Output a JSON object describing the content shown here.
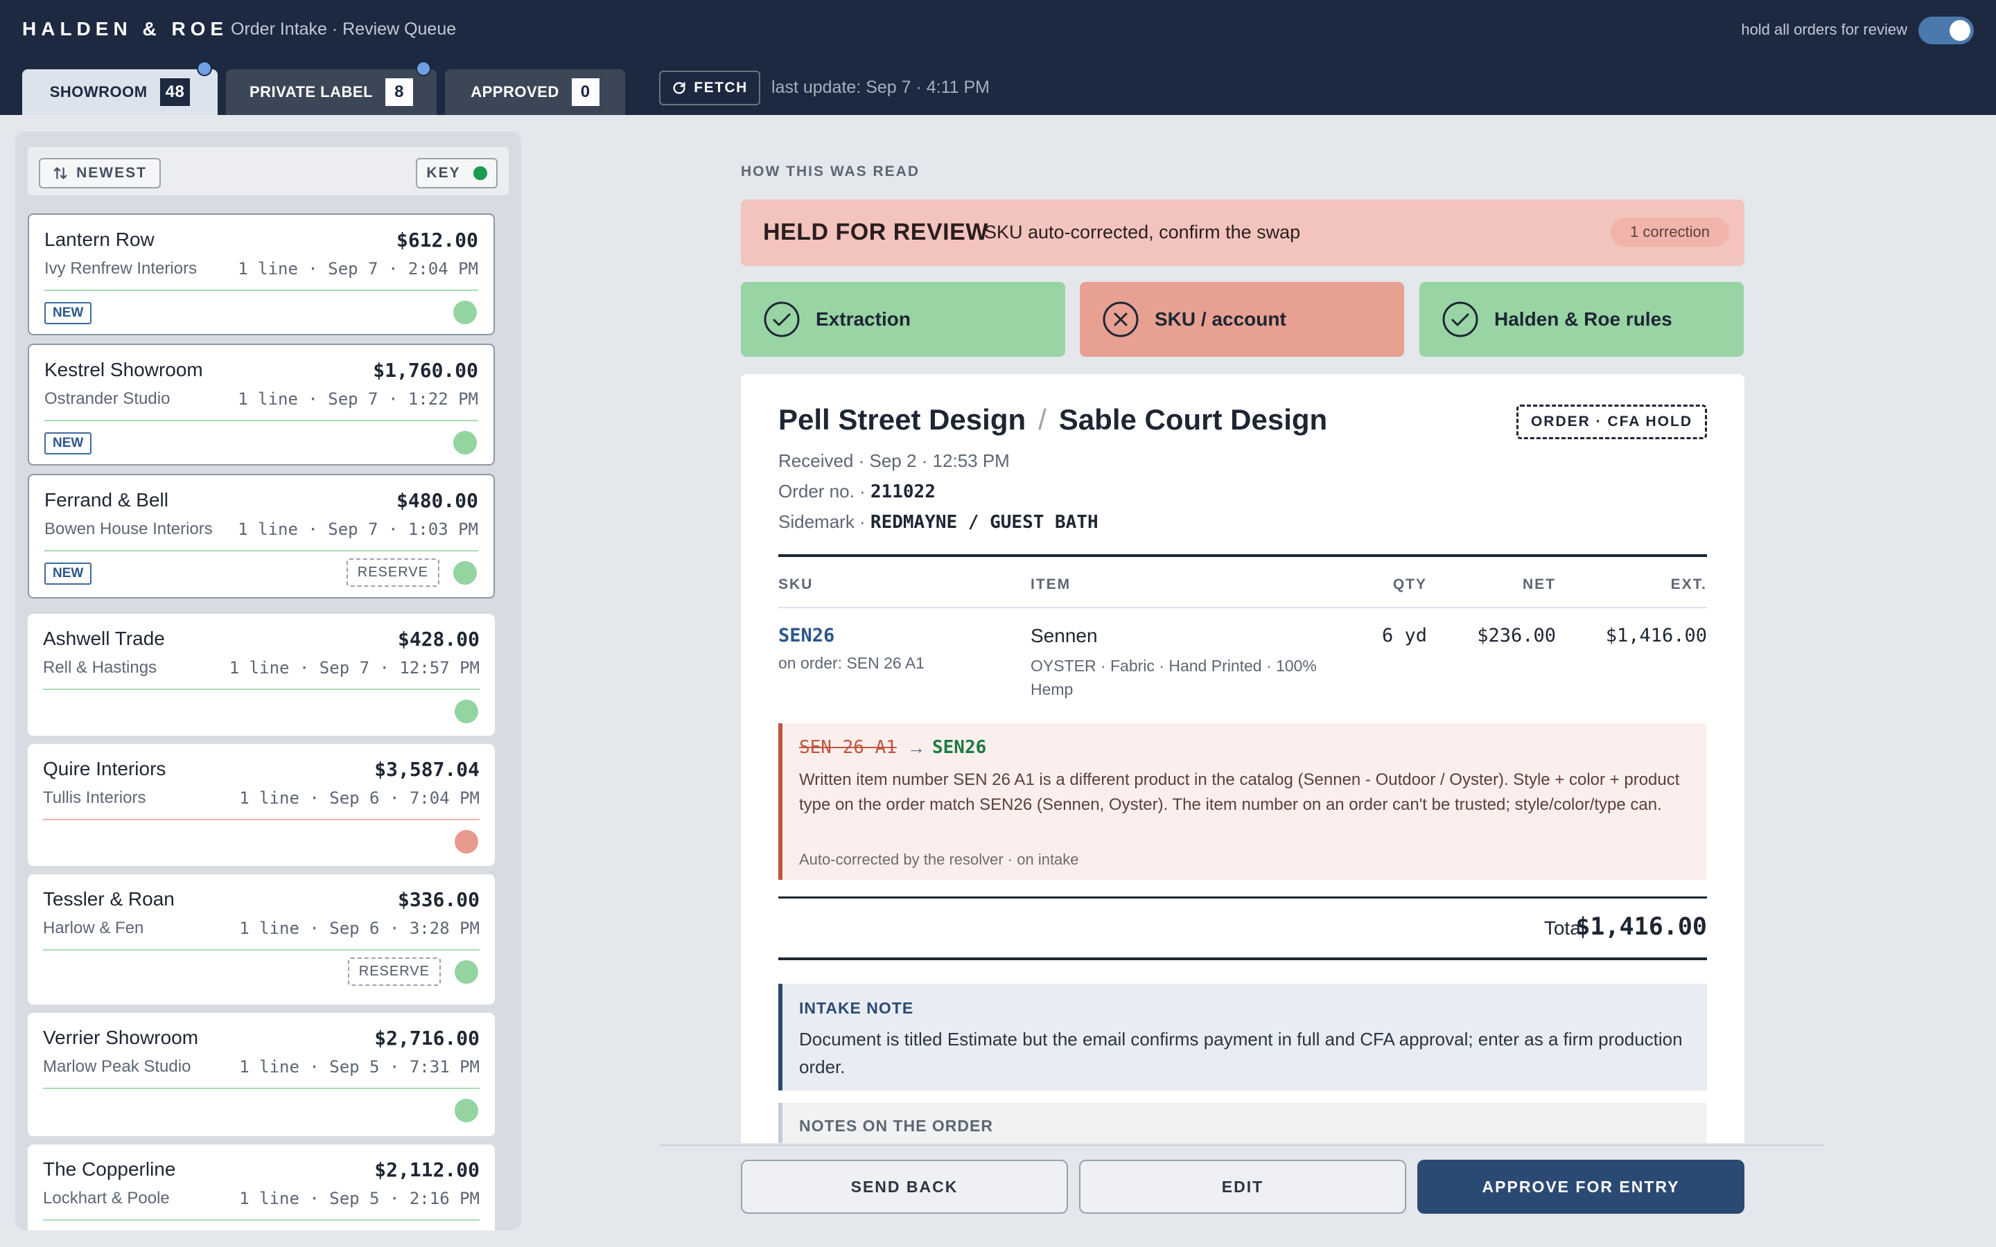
{
  "header": {
    "brand": "HALDEN & ROE",
    "subtitle": "Order Intake · Review Queue",
    "hold_label": "hold all orders for review",
    "tabs": [
      {
        "label": "SHOWROOM",
        "count": "48"
      },
      {
        "label": "PRIVATE LABEL",
        "count": "8"
      },
      {
        "label": "APPROVED",
        "count": "0"
      }
    ],
    "fetch_label": "FETCH",
    "last_update": "last update: Sep 7 · 4:11 PM",
    "colors": {
      "bar": "#1c2940",
      "accent": "#4b78ad",
      "unread_dot": "#6fa0e4"
    }
  },
  "sidebar": {
    "sort_label": "NEWEST",
    "key_label": "KEY",
    "orders": [
      {
        "name": "Lantern Row",
        "amount": "$612.00",
        "client": "Ivy Renfrew Interiors",
        "meta": "1 line · Sep 7 · 2:04 PM",
        "badge": "NEW",
        "reserve": "",
        "status": "green"
      },
      {
        "name": "Kestrel Showroom",
        "amount": "$1,760.00",
        "client": "Ostrander Studio",
        "meta": "1 line · Sep 7 · 1:22 PM",
        "badge": "NEW",
        "reserve": "",
        "status": "green"
      },
      {
        "name": "Ferrand & Bell",
        "amount": "$480.00",
        "client": "Bowen House Interiors",
        "meta": "1 line · Sep 7 · 1:03 PM",
        "badge": "NEW",
        "reserve": "RESERVE",
        "status": "green"
      },
      {
        "name": "Ashwell Trade",
        "amount": "$428.00",
        "client": "Rell & Hastings",
        "meta": "1 line · Sep 7 · 12:57 PM",
        "badge": "",
        "reserve": "",
        "status": "green"
      },
      {
        "name": "Quire Interiors",
        "amount": "$3,587.04",
        "client": "Tullis Interiors",
        "meta": "1 line · Sep 6 · 7:04 PM",
        "badge": "",
        "reserve": "",
        "status": "red"
      },
      {
        "name": "Tessler & Roan",
        "amount": "$336.00",
        "client": "Harlow & Fen",
        "meta": "1 line · Sep 6 · 3:28 PM",
        "badge": "",
        "reserve": "RESERVE",
        "status": "green"
      },
      {
        "name": "Verrier Showroom",
        "amount": "$2,716.00",
        "client": "Marlow Peak Studio",
        "meta": "1 line · Sep 5 · 7:31 PM",
        "badge": "",
        "reserve": "",
        "status": "green"
      },
      {
        "name": "The Copperline",
        "amount": "$2,112.00",
        "client": "Lockhart & Poole",
        "meta": "1 line · Sep 5 · 2:16 PM",
        "badge": "",
        "reserve": "",
        "status": "green"
      }
    ]
  },
  "review": {
    "section_label": "HOW THIS WAS READ",
    "held_title": "HELD FOR REVIEW",
    "held_sub": "SKU auto-corrected, confirm the swap",
    "held_count": "1 correction",
    "checks": [
      {
        "label": "Extraction",
        "state": "ok"
      },
      {
        "label": "SKU / account",
        "state": "bad"
      },
      {
        "label": "Halden & Roe rules",
        "state": "ok"
      }
    ]
  },
  "order": {
    "account": "Pell Street Design",
    "ship_to": "Sable Court Design",
    "stamp": "ORDER · CFA HOLD",
    "received": "Received · Sep 2 · 12:53 PM",
    "order_no_label": "Order no. · ",
    "order_no": "211022",
    "sidemark_label": "Sidemark · ",
    "sidemark": "REDMAYNE / GUEST BATH",
    "columns": {
      "sku": "SKU",
      "item": "ITEM",
      "qty": "QTY",
      "net": "NET",
      "ext": "EXT."
    },
    "line": {
      "sku": "SEN26",
      "on_order": "on order: SEN 26 A1",
      "item_name": "Sennen",
      "item_desc": "OYSTER · Fabric · Hand Printed · 100% Hemp",
      "qty": "6 yd",
      "net": "$236.00",
      "ext": "$1,416.00"
    },
    "correction": {
      "old": "SEN 26 A1",
      "arrow": "→",
      "new": "SEN26",
      "explanation": "Written item number SEN 26 A1 is a different product in the catalog (Sennen - Outdoor / Oyster). Style + color + product type on the order match SEN26 (Sennen, Oyster). The item number on an order can't be trusted; style/color/type can.",
      "by": "Auto-corrected by the resolver · on intake"
    },
    "total_label": "Total",
    "total": "$1,416.00",
    "intake_note_title": "INTAKE NOTE",
    "intake_note": "Document is titled Estimate but the email confirms payment in full and CFA approval; enter as a firm production order.",
    "notes_title": "NOTES ON THE ORDER"
  },
  "actions": {
    "send_back": "SEND BACK",
    "edit": "EDIT",
    "approve": "APPROVE FOR ENTRY"
  }
}
